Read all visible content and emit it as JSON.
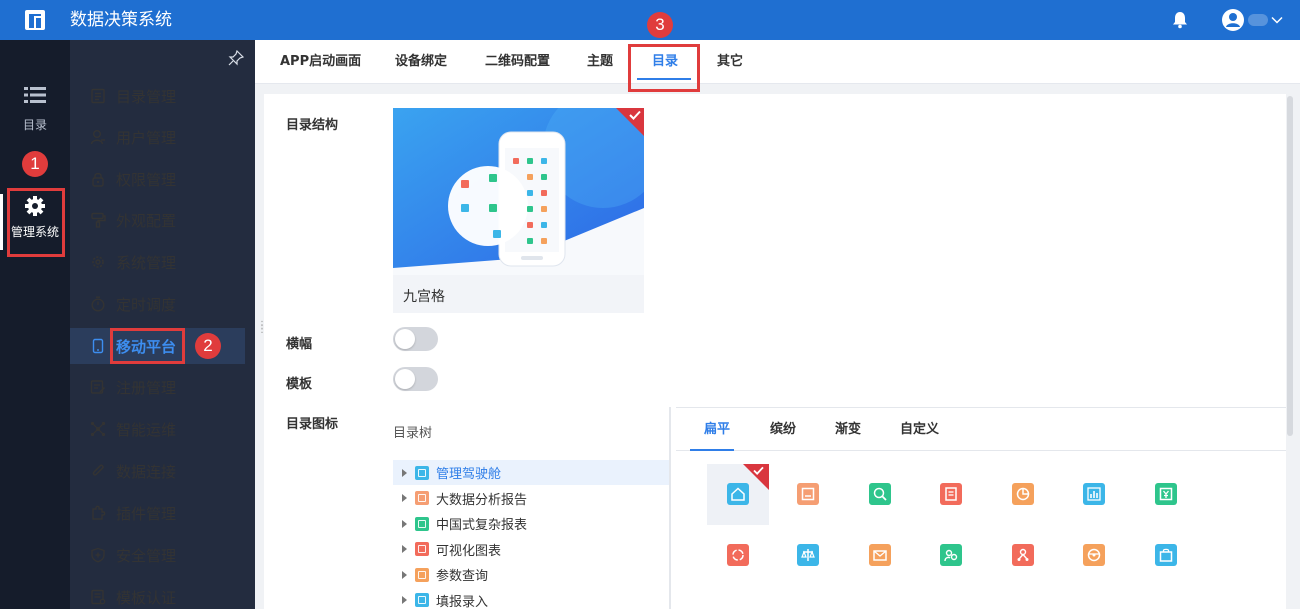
{
  "header": {
    "app_title": "数据决策系统",
    "icons": {
      "logo": "app-logo-icon",
      "bell": "bell-icon",
      "user": "user-avatar-icon",
      "dropdown": "chevron-down-icon"
    }
  },
  "rail": {
    "items": [
      {
        "label": "目录",
        "icon": "list-icon"
      },
      {
        "label": "管理系统",
        "icon": "gear-icon"
      }
    ]
  },
  "menu": {
    "items": [
      {
        "label": "目录管理",
        "icon": "directory-icon"
      },
      {
        "label": "用户管理",
        "icon": "user-icon"
      },
      {
        "label": "权限管理",
        "icon": "lock-icon"
      },
      {
        "label": "外观配置",
        "icon": "paint-icon"
      },
      {
        "label": "系统管理",
        "icon": "gear-icon"
      },
      {
        "label": "定时调度",
        "icon": "timer-icon"
      },
      {
        "label": "移动平台",
        "icon": "mobile-icon"
      },
      {
        "label": "注册管理",
        "icon": "register-icon"
      },
      {
        "label": "智能运维",
        "icon": "network-icon"
      },
      {
        "label": "数据连接",
        "icon": "link-icon"
      },
      {
        "label": "插件管理",
        "icon": "plugin-icon"
      },
      {
        "label": "安全管理",
        "icon": "shield-icon"
      },
      {
        "label": "模板认证",
        "icon": "template-icon"
      }
    ],
    "active_index": 6
  },
  "annotations": [
    "1",
    "2",
    "3"
  ],
  "tabs": {
    "items": [
      "APP启动画面",
      "设备绑定",
      "二维码配置",
      "主题",
      "目录",
      "其它"
    ],
    "active": "目录"
  },
  "form": {
    "structure_label": "目录结构",
    "structure_caption": "九宫格",
    "banner_label": "横幅",
    "banner_on": false,
    "template_label": "模板",
    "template_on": false,
    "icon_label": "目录图标"
  },
  "tree": {
    "title": "目录树",
    "items": [
      {
        "label": "管理驾驶舱",
        "color": "#3cb6e8"
      },
      {
        "label": "大数据分析报告",
        "color": "#f59e73"
      },
      {
        "label": "中国式复杂报表",
        "color": "#2ec58c"
      },
      {
        "label": "可视化图表",
        "color": "#f26b5b"
      },
      {
        "label": "参数查询",
        "color": "#f5a15c"
      },
      {
        "label": "填报录入",
        "color": "#3cb6e8"
      }
    ],
    "selected_index": 0
  },
  "icon_tabs": {
    "items": [
      "扁平",
      "缤纷",
      "渐变",
      "自定义"
    ],
    "active": "扁平"
  },
  "icon_grid": {
    "row1": [
      {
        "name": "home-icon",
        "color": "#3cb6e8"
      },
      {
        "name": "report-icon",
        "color": "#f59e73"
      },
      {
        "name": "search-icon",
        "color": "#2ec58c"
      },
      {
        "name": "document-icon",
        "color": "#f26b5b"
      },
      {
        "name": "pie-chart-icon",
        "color": "#f5a15c"
      },
      {
        "name": "bar-chart-icon",
        "color": "#3cb6e8"
      },
      {
        "name": "finance-icon",
        "color": "#2ec58c"
      }
    ],
    "row2": [
      {
        "name": "cycle-icon",
        "color": "#f26b5b"
      },
      {
        "name": "scale-icon",
        "color": "#3cb6e8"
      },
      {
        "name": "mail-icon",
        "color": "#f5a15c"
      },
      {
        "name": "team-icon",
        "color": "#2ec58c"
      },
      {
        "name": "org-icon",
        "color": "#f26b5b"
      },
      {
        "name": "steering-icon",
        "color": "#f5a15c"
      },
      {
        "name": "bag-icon",
        "color": "#3cb6e8"
      }
    ],
    "selected_index": 0
  }
}
